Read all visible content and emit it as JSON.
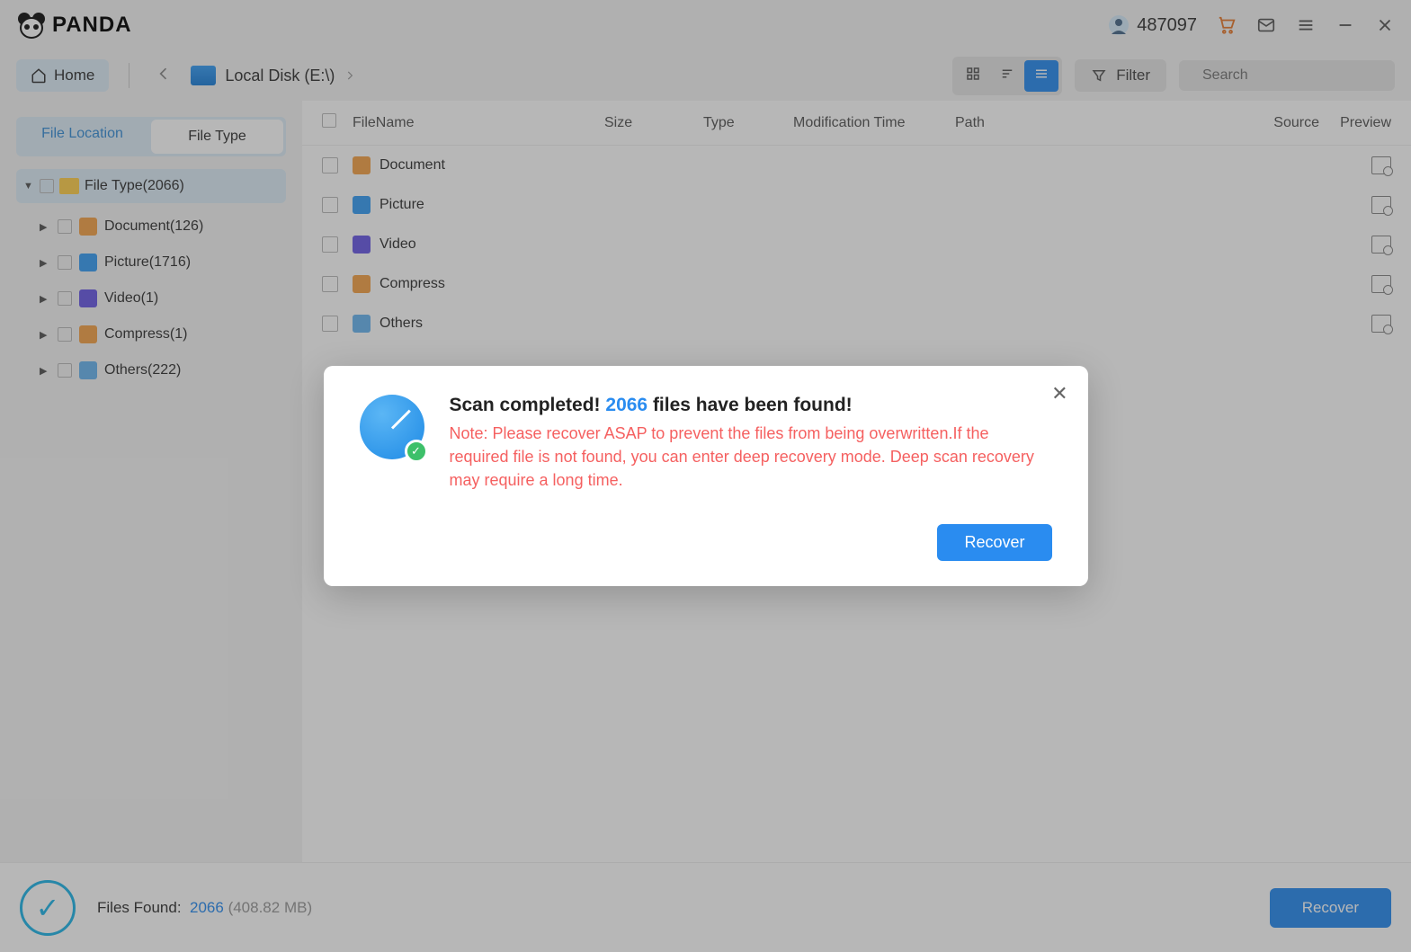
{
  "app": {
    "name": "PANDA",
    "user_id": "487097"
  },
  "toolbar": {
    "home": "Home",
    "breadcrumb": "Local Disk (E:\\)",
    "filter": "Filter",
    "search_placeholder": "Search"
  },
  "sidebar": {
    "tabs": {
      "location": "File Location",
      "type": "File Type"
    },
    "root": {
      "label": "File Type",
      "count": "(2066)"
    },
    "items": [
      {
        "label": "Document",
        "count": "(126)",
        "icon": "ic-doc"
      },
      {
        "label": "Picture",
        "count": "(1716)",
        "icon": "ic-pic"
      },
      {
        "label": "Video",
        "count": "(1)",
        "icon": "ic-vid"
      },
      {
        "label": "Compress",
        "count": "(1)",
        "icon": "ic-zip"
      },
      {
        "label": "Others",
        "count": "(222)",
        "icon": "ic-oth"
      }
    ]
  },
  "list": {
    "headers": {
      "name": "FileName",
      "size": "Size",
      "type": "Type",
      "mod": "Modification Time",
      "path": "Path",
      "source": "Source",
      "preview": "Preview"
    },
    "rows": [
      {
        "label": "Document",
        "icon": "ic-doc"
      },
      {
        "label": "Picture",
        "icon": "ic-pic"
      },
      {
        "label": "Video",
        "icon": "ic-vid"
      },
      {
        "label": "Compress",
        "icon": "ic-zip"
      },
      {
        "label": "Others",
        "icon": "ic-oth"
      }
    ]
  },
  "footer": {
    "label": "Files Found:",
    "count": "2066",
    "size": "(408.82 MB)",
    "recover": "Recover"
  },
  "dialog": {
    "title_pre": "Scan completed! ",
    "title_count": "2066",
    "title_post": " files have been found!",
    "note": "Note: Please recover ASAP to prevent the files from being overwritten.If the required file is not found, you can enter deep recovery mode. Deep scan recovery may require a long time.",
    "recover": "Recover"
  }
}
